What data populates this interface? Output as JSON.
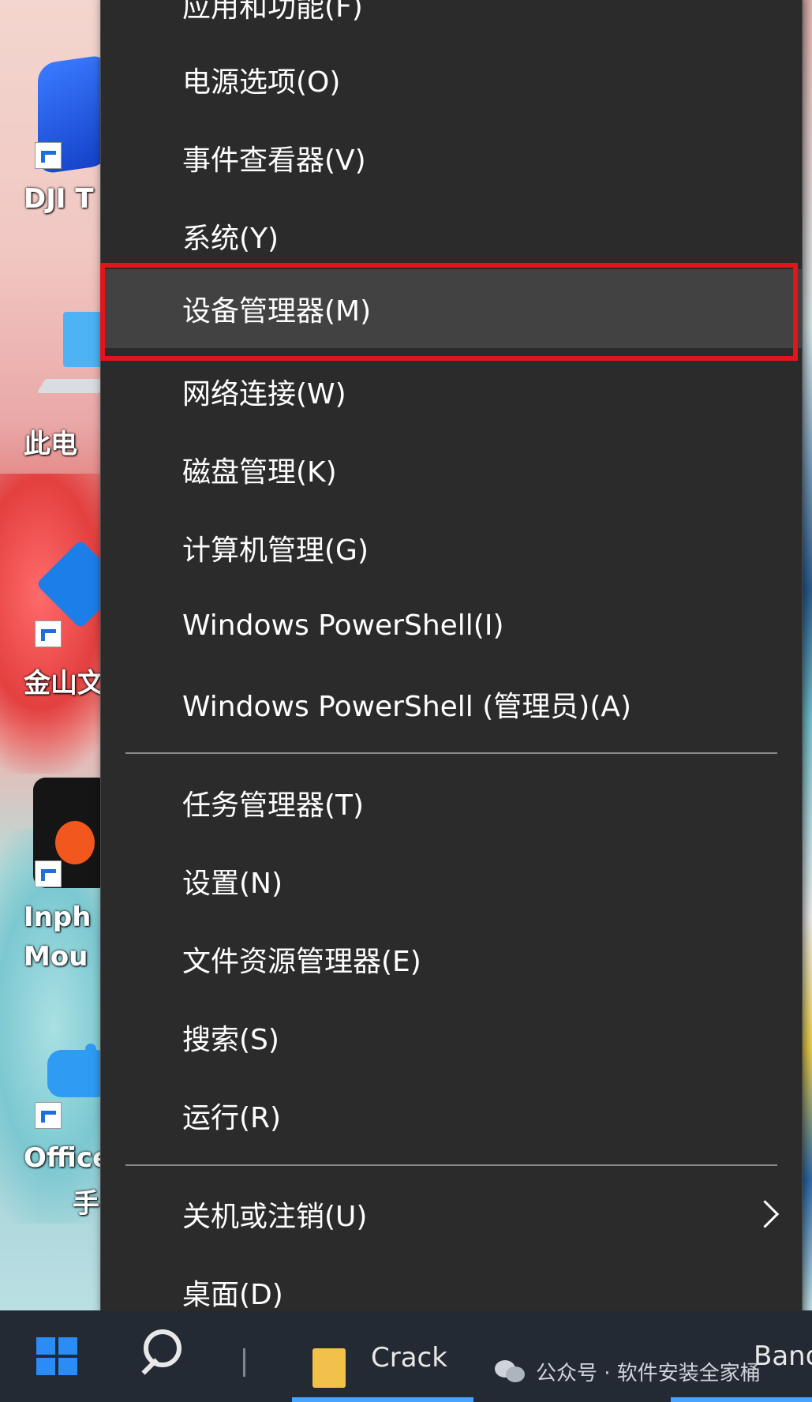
{
  "desktop": {
    "icons": [
      {
        "label": "DJI T"
      },
      {
        "label": "此电"
      },
      {
        "label": "金山文"
      },
      {
        "label_line1": "Inph",
        "label_line2": "Mou"
      },
      {
        "label_line1": "Office",
        "label_line2": "手"
      }
    ]
  },
  "menu": {
    "partial_top_label": "应用和功能(F)",
    "items": [
      {
        "label": "电源选项(O)"
      },
      {
        "label": "事件查看器(V)"
      },
      {
        "label": "系统(Y)"
      },
      {
        "label": "设备管理器(M)"
      },
      {
        "label": "网络连接(W)"
      },
      {
        "label": "磁盘管理(K)"
      },
      {
        "label": "计算机管理(G)"
      },
      {
        "label": "Windows PowerShell(I)"
      },
      {
        "label": "Windows PowerShell (管理员)(A)"
      },
      {
        "label": "任务管理器(T)"
      },
      {
        "label": "设置(N)"
      },
      {
        "label": "文件资源管理器(E)"
      },
      {
        "label": "搜索(S)"
      },
      {
        "label": "运行(R)"
      },
      {
        "label": "关机或注销(U)"
      },
      {
        "label": "桌面(D)"
      }
    ],
    "highlighted_item": "设备管理器(M)",
    "highlight_color": "#e0161c"
  },
  "taskbar": {
    "folder_label": "Crack",
    "right_label": "Band",
    "watermark": "公众号 · 软件安装全家桶"
  }
}
